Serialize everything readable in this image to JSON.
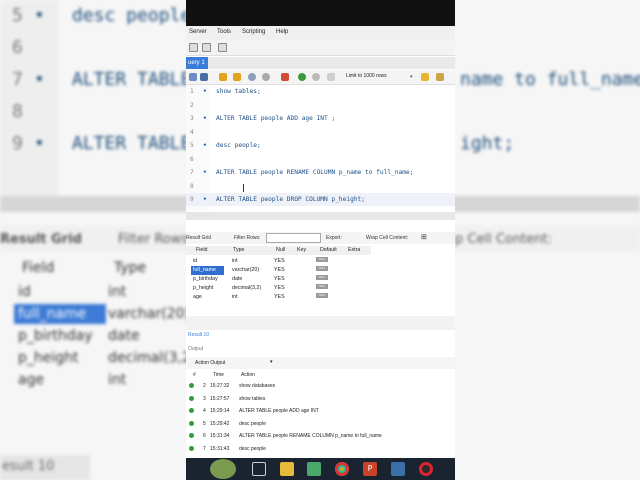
{
  "background": {
    "code_lines": [
      {
        "num": "5",
        "text": "desc people"
      },
      {
        "num": "6",
        "text": ""
      },
      {
        "num": "7",
        "text": "ALTER TABLE",
        "right": "name to full_name;"
      },
      {
        "num": "8",
        "text": ""
      },
      {
        "num": "9",
        "text": "ALTER TABLE",
        "right": "ight;"
      }
    ],
    "result_grid_label": "Result Grid",
    "filter_rows_label": "Filter Rows:",
    "wrap_label": "p Cell Content:",
    "grid_header": [
      "Field",
      "Type"
    ],
    "grid_rows": [
      [
        "id",
        "int"
      ],
      [
        "full_name",
        "varchar(20)"
      ],
      [
        "p_birthday",
        "date"
      ],
      [
        "p_height",
        "decimal(3,2)"
      ],
      [
        "age",
        "int"
      ]
    ],
    "bottom_tab": "esult 10"
  },
  "menu": [
    "Server",
    "Tools",
    "Scripting",
    "Help"
  ],
  "query_tab": "uery 1",
  "limit_label": "Limit to 1000 rows",
  "editor_lines": [
    {
      "num": "1",
      "dot": "•",
      "text": "show tables;"
    },
    {
      "num": "2",
      "dot": "",
      "text": ""
    },
    {
      "num": "3",
      "dot": "•",
      "text": "ALTER TABLE people ADD age INT ;"
    },
    {
      "num": "4",
      "dot": "",
      "text": ""
    },
    {
      "num": "5",
      "dot": "•",
      "text": "desc people;"
    },
    {
      "num": "6",
      "dot": "",
      "text": ""
    },
    {
      "num": "7",
      "dot": "•",
      "text": "ALTER TABLE people RENAME COLUMN p_name to full_name;"
    },
    {
      "num": "8",
      "dot": "",
      "text": ""
    },
    {
      "num": "9",
      "dot": "•",
      "text": "ALTER TABLE people DROP COLUMN p_height;"
    }
  ],
  "result_toolbar": {
    "result_grid": "Result Grid",
    "filter_rows": "Filter Rows:",
    "export": "Export:",
    "wrap": "Wrap Cell Content:"
  },
  "grid": {
    "headers": [
      "Field",
      "Type",
      "Null",
      "Key",
      "Default",
      "Extra"
    ],
    "rows": [
      {
        "field": "id",
        "type": "int",
        "null": "YES",
        "default": "NULL"
      },
      {
        "field": "full_name",
        "type": "varchar(20)",
        "null": "YES",
        "default": "NULL"
      },
      {
        "field": "p_birthday",
        "type": "date",
        "null": "YES",
        "default": "NULL"
      },
      {
        "field": "p_height",
        "type": "decimal(3,2)",
        "null": "YES",
        "default": "NULL"
      },
      {
        "field": "age",
        "type": "int",
        "null": "YES",
        "default": "NULL"
      }
    ]
  },
  "result_tab": "Result 10",
  "output_header": "Output",
  "output_selector": "Action Output",
  "action_log": {
    "headers": [
      "#",
      "Time",
      "Action"
    ],
    "rows": [
      {
        "num": "2",
        "time": "15:27:32",
        "action": "show databases"
      },
      {
        "num": "3",
        "time": "15:27:57",
        "action": "show tables"
      },
      {
        "num": "4",
        "time": "15:29:14",
        "action": "ALTER TABLE people ADD age INT"
      },
      {
        "num": "5",
        "time": "15:29:42",
        "action": "desc people"
      },
      {
        "num": "6",
        "time": "15:31:34",
        "action": "ALTER TABLE people RENAME COLUMN p_name to full_name"
      },
      {
        "num": "7",
        "time": "15:31:43",
        "action": "desc people"
      }
    ]
  },
  "taskbar_apps": [
    "start-icon",
    "task-view-icon",
    "file-explorer-icon",
    "calculator-icon",
    "chrome-icon",
    "powerpoint-icon",
    "mysql-workbench-icon",
    "screen-recorder-icon"
  ]
}
